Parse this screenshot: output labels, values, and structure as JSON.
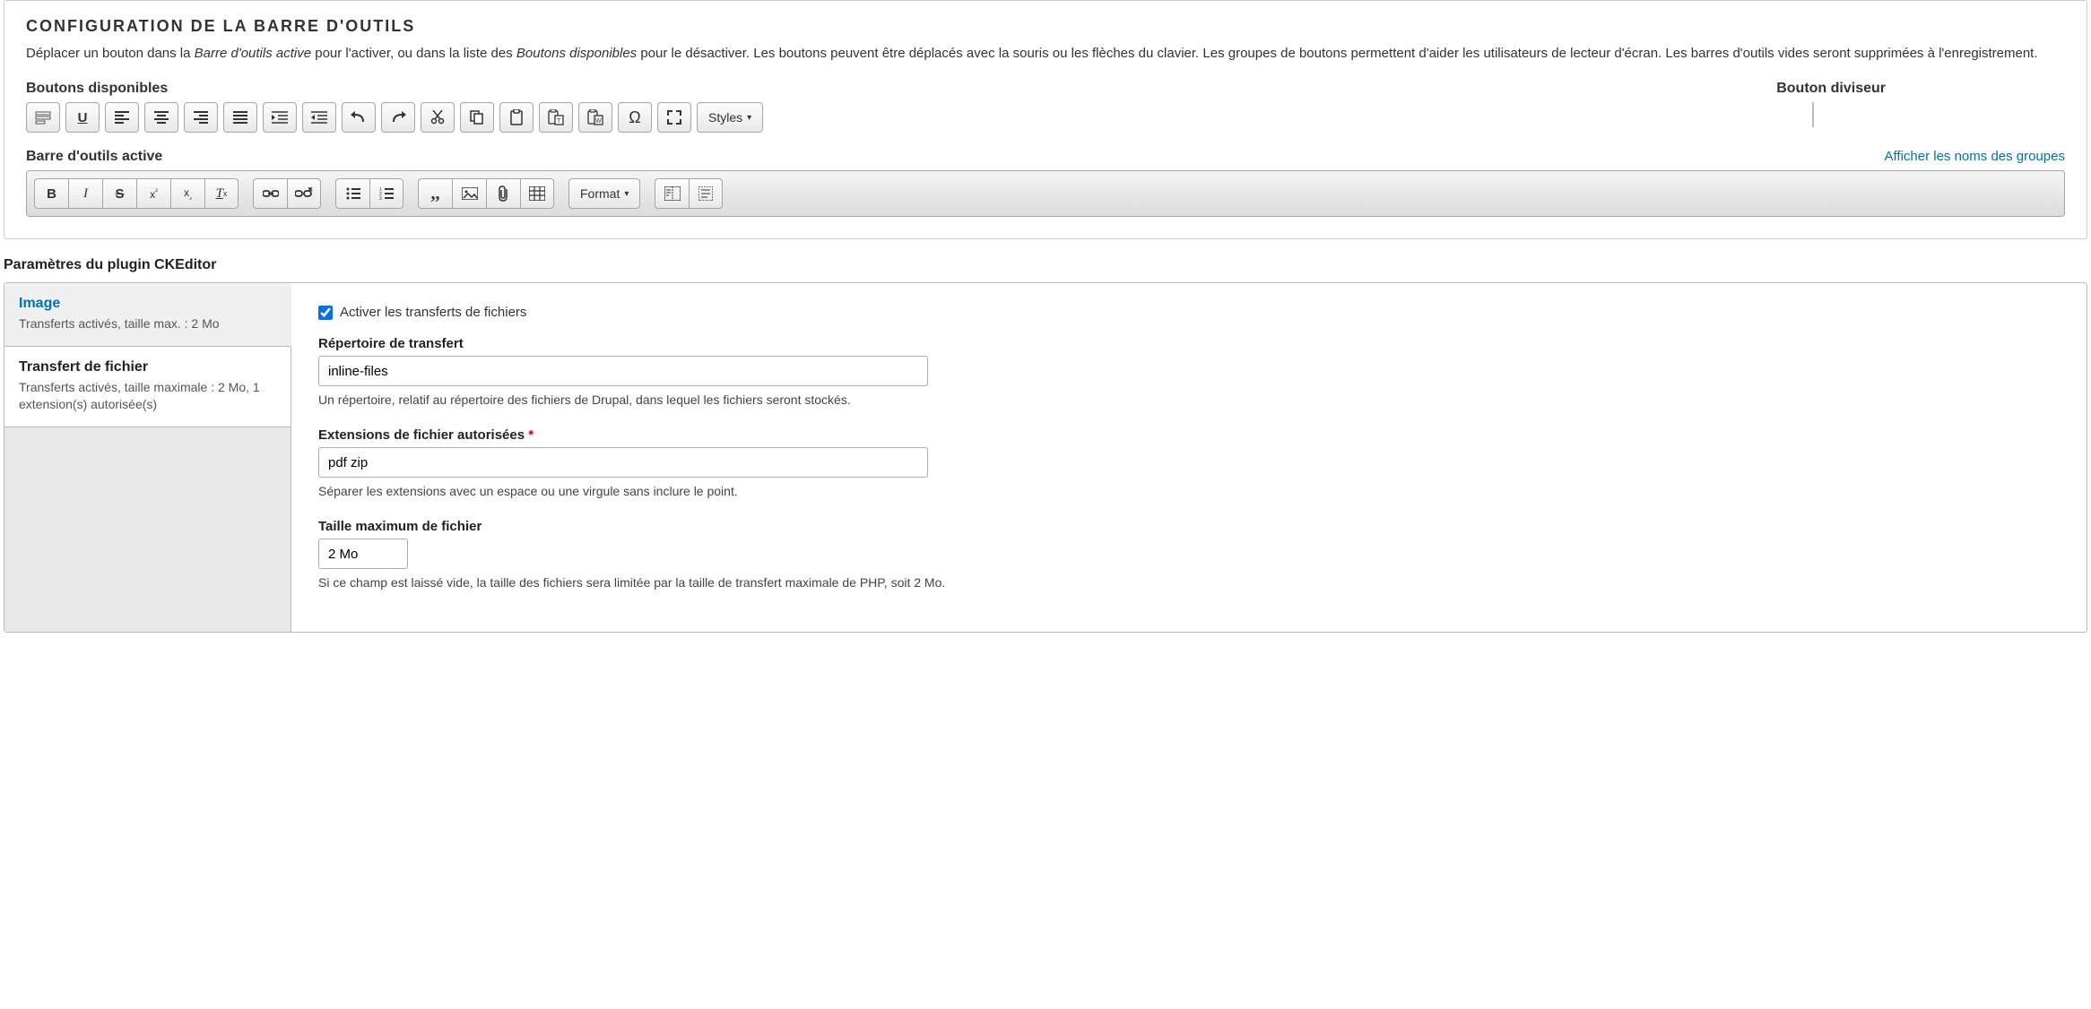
{
  "toolbar_config": {
    "title": "Configuration de la barre d'outils",
    "desc_1": "Déplacer un bouton dans la ",
    "desc_em1": "Barre d'outils active",
    "desc_2": " pour l'activer, ou dans la liste des ",
    "desc_em2": "Boutons disponibles",
    "desc_3": " pour le désactiver. Les boutons peuvent être déplacés avec la souris ou les flèches du clavier. Les groupes de boutons permettent d'aider les utilisateurs de lecteur d'écran. Les barres d'outils vides seront supprimées à l'enregistrement.",
    "available_label": "Boutons disponibles",
    "divider_label": "Bouton diviseur",
    "active_label": "Barre d'outils active",
    "show_groups_link": "Afficher les noms des groupes",
    "styles_label": "Styles",
    "format_label": "Format",
    "available_buttons": [
      "language",
      "underline",
      "align-left",
      "align-center",
      "align-right",
      "align-justify",
      "indent",
      "outdent",
      "undo",
      "redo",
      "cut",
      "copy",
      "paste",
      "paste-text",
      "paste-word",
      "omega",
      "maximize"
    ],
    "active_groups": [
      [
        "bold",
        "italic",
        "strike",
        "superscript",
        "subscript",
        "remove-format"
      ],
      [
        "link",
        "unlink"
      ],
      [
        "bullet-list",
        "number-list"
      ],
      [
        "blockquote",
        "image",
        "attachment",
        "table"
      ],
      [
        "format-dropdown"
      ],
      [
        "source",
        "show-blocks"
      ]
    ]
  },
  "plugin": {
    "heading": "Paramètres du plugin CKEditor",
    "tabs": [
      {
        "title": "Image",
        "desc": "Transferts activés, taille max. : 2 Mo"
      },
      {
        "title": "Transfert de fichier",
        "desc": "Transferts activés, taille maximale : 2 Mo, 1 extension(s) autorisée(s)"
      }
    ],
    "content": {
      "enable_uploads_label": "Activer les transferts de fichiers",
      "enable_uploads_checked": true,
      "upload_dir": {
        "label": "Répertoire de transfert",
        "value": "inline-files",
        "help": "Un répertoire, relatif au répertoire des fichiers de Drupal, dans lequel les fichiers seront stockés."
      },
      "allowed_ext": {
        "label": "Extensions de fichier autorisées",
        "required_marker": "*",
        "value": "pdf zip",
        "help": "Séparer les extensions avec un espace ou une virgule sans inclure le point."
      },
      "max_size": {
        "label": "Taille maximum de fichier",
        "value": "2 Mo",
        "help": "Si ce champ est laissé vide, la taille des fichiers sera limitée par la taille de transfert maximale de PHP, soit 2 Mo."
      }
    }
  }
}
